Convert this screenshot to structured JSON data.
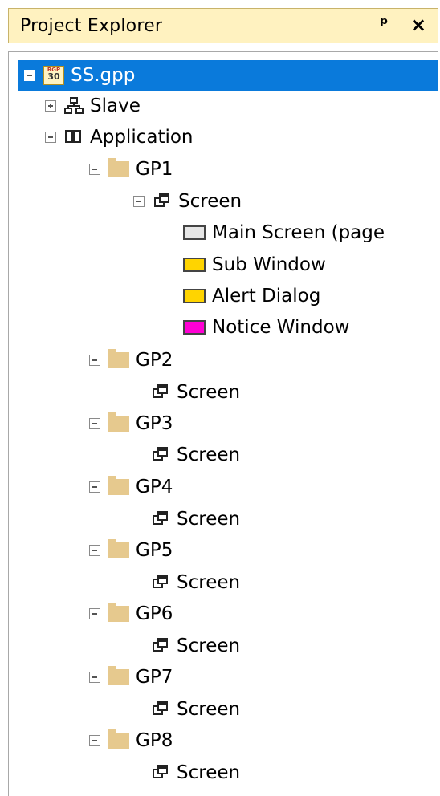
{
  "header": {
    "title": "Project Explorer",
    "pin_glyph": "ᵖ",
    "close_glyph": "×"
  },
  "tree": {
    "root": {
      "label": "SS.gpp",
      "icon_top": "RGP",
      "icon_num": "30"
    },
    "slave": {
      "label": "Slave"
    },
    "application": {
      "label": "Application"
    },
    "groups": [
      {
        "label": "GP1",
        "screen_label": "Screen",
        "screens": [
          {
            "label": "Main Screen (page",
            "color": "#e6e6e6"
          },
          {
            "label": "Sub Window",
            "color": "#ffd400"
          },
          {
            "label": "Alert Dialog",
            "color": "#ffd400"
          },
          {
            "label": "Notice Window",
            "color": "#ff00d4"
          }
        ]
      },
      {
        "label": "GP2",
        "screen_label": "Screen"
      },
      {
        "label": "GP3",
        "screen_label": "Screen"
      },
      {
        "label": "GP4",
        "screen_label": "Screen"
      },
      {
        "label": "GP5",
        "screen_label": "Screen"
      },
      {
        "label": "GP6",
        "screen_label": "Screen"
      },
      {
        "label": "GP7",
        "screen_label": "Screen"
      },
      {
        "label": "GP8",
        "screen_label": "Screen"
      }
    ]
  },
  "colors": {
    "selection": "#0a7adb",
    "header_bg": "#fff2c0",
    "folder": "#e6c98e"
  }
}
